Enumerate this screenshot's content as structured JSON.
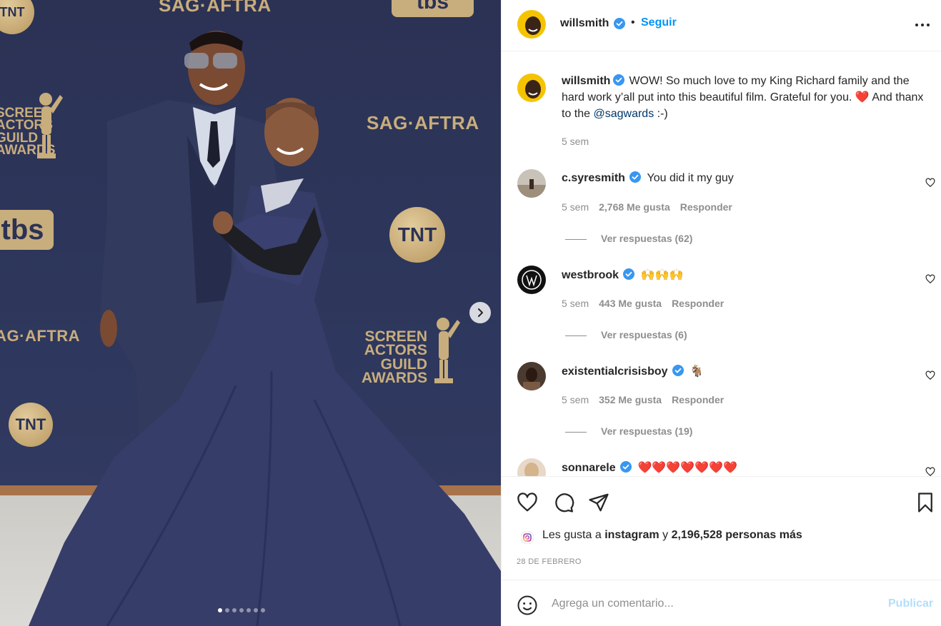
{
  "post": {
    "author": "willsmith",
    "follow_label": "Seguir",
    "bullet": "•",
    "caption_parts": {
      "before": "WOW! So much love to my King Richard family and the hard work y’all put into this beautiful film. Grateful for you. ",
      "heart": "❤️",
      "middle": " And thanx to the ",
      "mention": "@sagwards",
      "after": " :-)"
    },
    "caption_time": "5 sem",
    "image_carousel": {
      "slide_count": 7,
      "active_slide": 1
    },
    "backdrop_logos": {
      "sag_aftra": "SAG·AFTRA",
      "sag_aftra_cut": "SAG·AFTRA",
      "tnt": "TNT",
      "tbs": "tbs",
      "sag_awards": [
        "SCREEN",
        "ACTORS",
        "GUILD",
        "AWARDS"
      ]
    }
  },
  "comments": [
    {
      "user": "c.syresmith",
      "text": "You did it my guy",
      "time": "5 sem",
      "likes": "2,768 Me gusta",
      "reply": "Responder",
      "view_replies": "Ver respuestas (62)"
    },
    {
      "user": "westbrook",
      "text": "🙌🙌🙌",
      "time": "5 sem",
      "likes": "443 Me gusta",
      "reply": "Responder",
      "view_replies": "Ver respuestas (6)"
    },
    {
      "user": "existentialcrisisboy",
      "text": "🐐",
      "time": "5 sem",
      "likes": "352 Me gusta",
      "reply": "Responder",
      "view_replies": "Ver respuestas (19)"
    },
    {
      "user": "sonnarele",
      "text": "❤️❤️❤️❤️❤️❤️❤️"
    }
  ],
  "likes_line": {
    "prefix": "Les gusta a",
    "account": "instagram",
    "conj": "y",
    "count": "2,196,528 personas más"
  },
  "date": "28 DE FEBRERO",
  "add_comment": {
    "placeholder": "Agrega un comentario...",
    "publish_label": "Publicar"
  },
  "colors": {
    "accent": "#0095f6",
    "publish_disabled": "#b2dffc",
    "secondary_text": "#8e8e8e",
    "verified": "#3897f0",
    "backdrop": "#2e375d",
    "gold": "#c8ad7d"
  },
  "icons": [
    "verified-badge-icon",
    "more-options-icon",
    "heart-icon",
    "comment-icon",
    "share-icon",
    "bookmark-icon",
    "emoji-icon",
    "chevron-right-icon",
    "instagram-logo-icon"
  ]
}
